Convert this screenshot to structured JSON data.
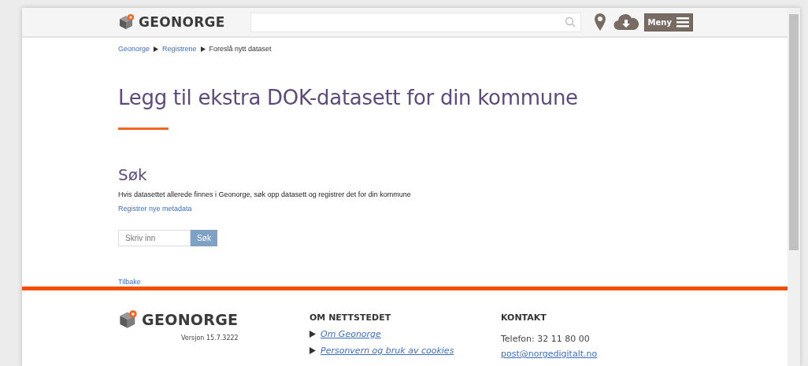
{
  "header": {
    "logo": "GEONORGE",
    "menu_button": "Meny"
  },
  "breadcrumb": [
    {
      "label": "Geonorge",
      "link": true
    },
    {
      "label": "Registrene",
      "link": true
    },
    {
      "label": "Foreslå nytt dataset",
      "link": false
    }
  ],
  "title": "Legg til ekstra DOK-datasett for din kommune",
  "search_section": {
    "heading": "Søk",
    "description": "Hvis datasettet allerede finnes i Geonorge, søk opp datasett og registrer det for din kommune",
    "register_link": "Registrer nye metadata",
    "field": {
      "placeholder": "Skriv inn"
    },
    "button": "Søk"
  },
  "back_link": "Tilbake",
  "footer": {
    "logo": "GEONORGE",
    "version": "Versjon 15.7.3222",
    "about": {
      "heading": "OM NETTSTEDET",
      "links": [
        "Om Geonorge",
        "Personvern og bruk av cookies"
      ]
    },
    "contact": {
      "heading": "KONTAKT",
      "phone": "Telefon: 32 11 80 00",
      "email": "post@norgedigitalt.no"
    }
  }
}
